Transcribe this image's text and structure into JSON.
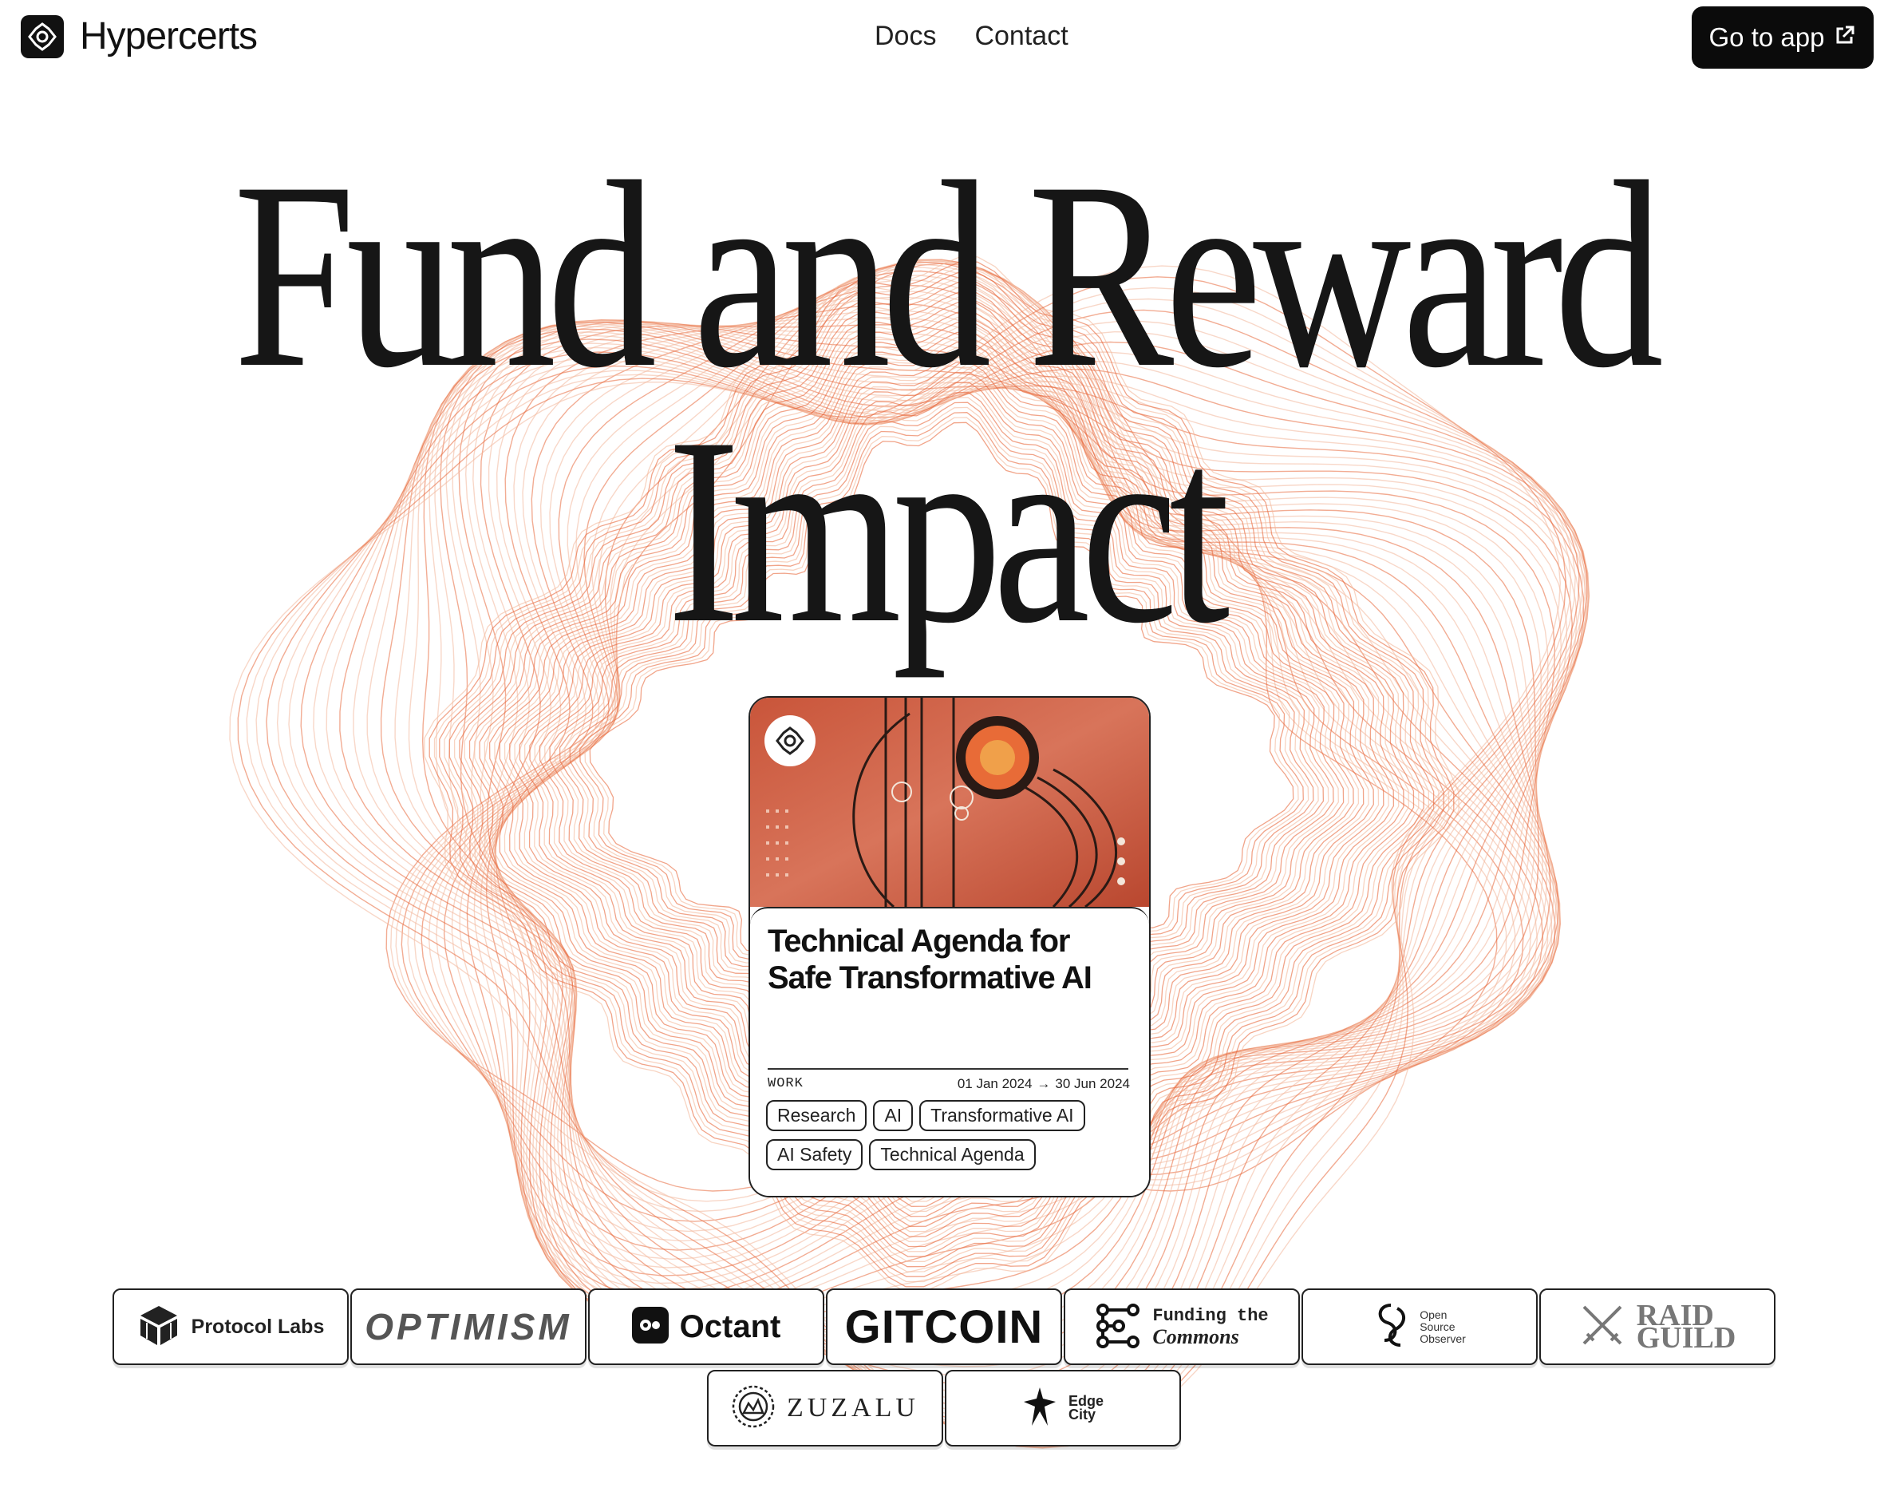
{
  "header": {
    "brand": "Hypercerts",
    "nav": [
      {
        "label": "Docs"
      },
      {
        "label": "Contact"
      }
    ],
    "cta_label": "Go to app"
  },
  "hero": {
    "line1": "Fund and Reward",
    "line2": "Impact"
  },
  "card": {
    "title": "Technical Agenda for Safe Transformative AI",
    "kind": "WORK",
    "start_date": "01 Jan 2024",
    "arrow": "→",
    "end_date": "30 Jun 2024",
    "tags": [
      "Research",
      "AI",
      "Transformative AI",
      "AI Safety",
      "Technical Agenda"
    ]
  },
  "partners": {
    "protocol_labs": "Protocol Labs",
    "optimism": "OPTIMISM",
    "octant": "Octant",
    "gitcoin": "GITCOIN",
    "ftc_line1": "Funding the",
    "ftc_line2": "Commons",
    "oso_line1": "Open",
    "oso_line2": "Source",
    "oso_line3": "Observer",
    "raid_line1": "RAID",
    "raid_line2": "GUILD",
    "zuzalu": "ZUZALU",
    "edge_line1": "Edge",
    "edge_line2": "City"
  },
  "colors": {
    "accent": "#e8673a",
    "accent_light": "#f3b79a",
    "text": "#161616",
    "background": "#ffffff"
  },
  "icons": [
    "hypercerts-logo-icon",
    "external-link-icon",
    "protocol-labs-cube-icon",
    "octant-icon",
    "ftc-network-icon",
    "oso-swirl-icon",
    "raid-guild-swords-icon",
    "zuzalu-emblem-icon",
    "edge-city-bird-icon"
  ]
}
